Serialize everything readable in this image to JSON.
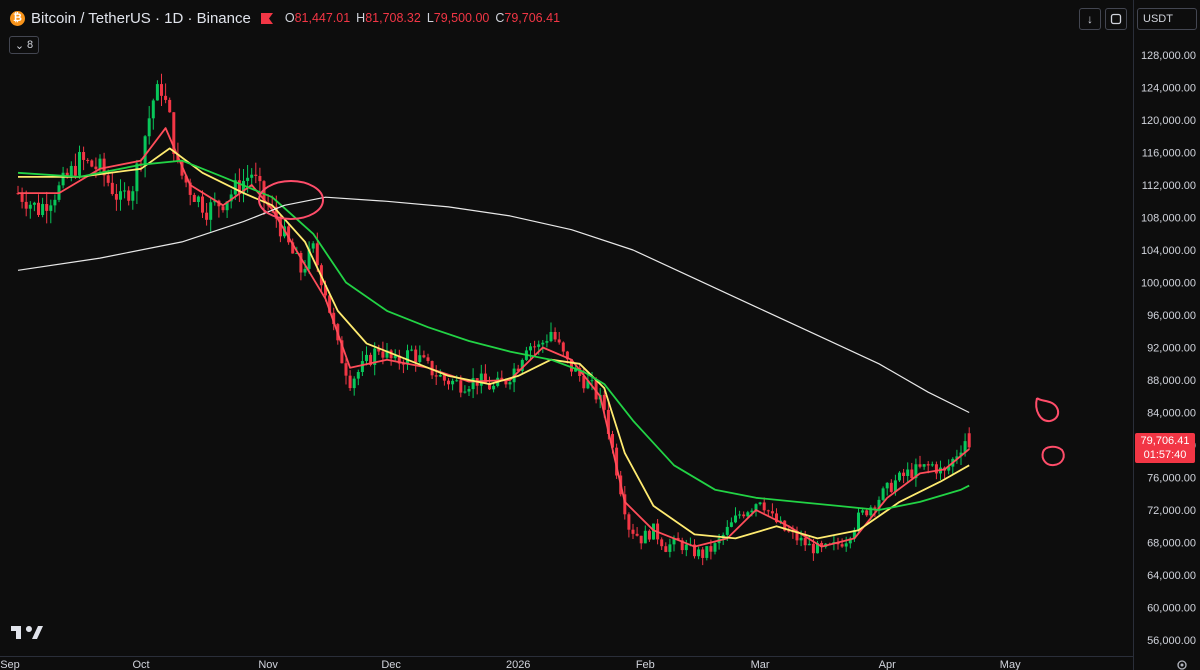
{
  "header": {
    "symbol": "Bitcoin / TetherUS · 1D · Binance",
    "coin_glyph": "₿",
    "ohlc": [
      {
        "key": "O",
        "value": "81,447.01"
      },
      {
        "key": "H",
        "value": "81,708.32"
      },
      {
        "key": "L",
        "value": "79,500.00"
      },
      {
        "key": "C",
        "value": "79,706.41"
      }
    ],
    "down_color": "#f23645",
    "up_color": "#08c75a"
  },
  "indicators": {
    "count": "8"
  },
  "toolbar": {
    "currency": "USDT"
  },
  "price_label": {
    "price": "79,706.41",
    "countdown": "01:57:40"
  },
  "chart_data": {
    "type": "line",
    "title": "",
    "ylim": [
      54000,
      130000
    ],
    "y_ticks": [
      128000,
      124000,
      120000,
      116000,
      112000,
      108000,
      104000,
      100000,
      96000,
      92000,
      88000,
      84000,
      80000,
      76000,
      72000,
      68000,
      64000,
      60000,
      56000
    ],
    "y_tick_labels": [
      "128,000.00",
      "124,000.00",
      "120,000.00",
      "116,000.00",
      "112,000.00",
      "108,000.00",
      "104,000.00",
      "100,000.00",
      "96,000.00",
      "92,000.00",
      "88,000.00",
      "84,000.00",
      "80,000.00",
      "76,000.00",
      "72,000.00",
      "68,000.00",
      "64,000.00",
      "60,000.00",
      "56,000.00"
    ],
    "x_ticks": [
      "Sep",
      "Oct",
      "Nov",
      "Dec",
      "2026",
      "Feb",
      "Mar",
      "Apr",
      "May"
    ],
    "x_tick_days": [
      0,
      30,
      61,
      91,
      122,
      153,
      181,
      212,
      242
    ],
    "grid": false,
    "candles": {
      "name": "BTC/USDT 1D",
      "path": [
        [
          0,
          111000
        ],
        [
          5,
          109000
        ],
        [
          10,
          111500
        ],
        [
          15,
          115000
        ],
        [
          20,
          114000
        ],
        [
          25,
          110000
        ],
        [
          28,
          112000
        ],
        [
          30,
          116000
        ],
        [
          33,
          122500
        ],
        [
          35,
          124000
        ],
        [
          37,
          120000
        ],
        [
          39,
          114000
        ],
        [
          42,
          111500
        ],
        [
          46,
          109000
        ],
        [
          50,
          110000
        ],
        [
          54,
          112000
        ],
        [
          57,
          113500
        ],
        [
          60,
          110000
        ],
        [
          63,
          108000
        ],
        [
          66,
          104500
        ],
        [
          69,
          101500
        ],
        [
          72,
          104000
        ],
        [
          75,
          99000
        ],
        [
          78,
          92000
        ],
        [
          81,
          88000
        ],
        [
          84,
          89500
        ],
        [
          88,
          92000
        ],
        [
          92,
          90000
        ],
        [
          96,
          91500
        ],
        [
          100,
          89500
        ],
        [
          104,
          88000
        ],
        [
          108,
          87500
        ],
        [
          112,
          88000
        ],
        [
          116,
          87000
        ],
        [
          119,
          88000
        ],
        [
          122,
          90000
        ],
        [
          124,
          92500
        ],
        [
          127,
          92000
        ],
        [
          130,
          94000
        ],
        [
          132,
          92000
        ],
        [
          134,
          90000
        ],
        [
          137,
          88500
        ],
        [
          140,
          87000
        ],
        [
          143,
          84500
        ],
        [
          146,
          77000
        ],
        [
          149,
          70000
        ],
        [
          152,
          68500
        ],
        [
          155,
          69500
        ],
        [
          158,
          67500
        ],
        [
          161,
          68000
        ],
        [
          164,
          67000
        ],
        [
          167,
          66500
        ],
        [
          170,
          67500
        ],
        [
          173,
          69500
        ],
        [
          176,
          71500
        ],
        [
          179,
          72500
        ],
        [
          181,
          73500
        ],
        [
          184,
          71000
        ],
        [
          187,
          69500
        ],
        [
          190,
          68500
        ],
        [
          193,
          67500
        ],
        [
          196,
          67000
        ],
        [
          199,
          67500
        ],
        [
          202,
          68500
        ],
        [
          205,
          71000
        ],
        [
          208,
          72500
        ],
        [
          211,
          74000
        ],
        [
          214,
          75500
        ],
        [
          217,
          76500
        ],
        [
          220,
          77000
        ],
        [
          223,
          77500
        ],
        [
          226,
          76500
        ],
        [
          229,
          79000
        ],
        [
          232,
          81500
        ]
      ],
      "last_close": 79706.41
    },
    "series": [
      {
        "name": "",
        "color": "#ff4d5a",
        "values": [
          [
            0,
            111000
          ],
          [
            10,
            111000
          ],
          [
            20,
            114000
          ],
          [
            30,
            115000
          ],
          [
            36,
            119000
          ],
          [
            42,
            112000
          ],
          [
            50,
            109500
          ],
          [
            57,
            112000
          ],
          [
            62,
            109000
          ],
          [
            69,
            103000
          ],
          [
            75,
            98000
          ],
          [
            81,
            89500
          ],
          [
            90,
            90500
          ],
          [
            100,
            89500
          ],
          [
            110,
            87800
          ],
          [
            120,
            88000
          ],
          [
            128,
            92000
          ],
          [
            135,
            90500
          ],
          [
            142,
            86000
          ],
          [
            148,
            73000
          ],
          [
            155,
            69500
          ],
          [
            165,
            67500
          ],
          [
            173,
            68500
          ],
          [
            180,
            72000
          ],
          [
            188,
            70000
          ],
          [
            196,
            67500
          ],
          [
            204,
            68500
          ],
          [
            212,
            73500
          ],
          [
            220,
            76500
          ],
          [
            226,
            77000
          ],
          [
            232,
            79500
          ]
        ]
      },
      {
        "name": "",
        "color": "#ffeb70",
        "values": [
          [
            0,
            113000
          ],
          [
            15,
            113000
          ],
          [
            30,
            114000
          ],
          [
            37,
            116500
          ],
          [
            45,
            113500
          ],
          [
            55,
            111000
          ],
          [
            62,
            109500
          ],
          [
            70,
            105000
          ],
          [
            78,
            96500
          ],
          [
            85,
            92500
          ],
          [
            95,
            90500
          ],
          [
            105,
            88500
          ],
          [
            115,
            87500
          ],
          [
            122,
            88500
          ],
          [
            130,
            90500
          ],
          [
            137,
            90000
          ],
          [
            143,
            87000
          ],
          [
            148,
            79000
          ],
          [
            155,
            72500
          ],
          [
            165,
            69000
          ],
          [
            175,
            68500
          ],
          [
            185,
            70000
          ],
          [
            195,
            68500
          ],
          [
            205,
            69500
          ],
          [
            215,
            73000
          ],
          [
            225,
            75500
          ],
          [
            232,
            77500
          ]
        ]
      },
      {
        "name": "",
        "color": "#22d345",
        "values": [
          [
            0,
            113500
          ],
          [
            15,
            113000
          ],
          [
            30,
            114500
          ],
          [
            40,
            115000
          ],
          [
            50,
            113000
          ],
          [
            62,
            110500
          ],
          [
            72,
            106000
          ],
          [
            80,
            100000
          ],
          [
            90,
            96500
          ],
          [
            100,
            94500
          ],
          [
            110,
            92800
          ],
          [
            120,
            91500
          ],
          [
            130,
            90500
          ],
          [
            138,
            89000
          ],
          [
            143,
            87500
          ],
          [
            150,
            83000
          ],
          [
            160,
            77500
          ],
          [
            170,
            74500
          ],
          [
            180,
            73500
          ],
          [
            190,
            73000
          ],
          [
            200,
            72500
          ],
          [
            210,
            72000
          ],
          [
            220,
            73000
          ],
          [
            230,
            74500
          ],
          [
            232,
            75000
          ]
        ]
      },
      {
        "name": "",
        "color": "#e8e8e8",
        "values": [
          [
            0,
            101500
          ],
          [
            20,
            103000
          ],
          [
            40,
            105000
          ],
          [
            55,
            107500
          ],
          [
            65,
            109500
          ],
          [
            75,
            110500
          ],
          [
            90,
            110000
          ],
          [
            105,
            109300
          ],
          [
            120,
            108200
          ],
          [
            135,
            106500
          ],
          [
            150,
            104000
          ],
          [
            165,
            100500
          ],
          [
            180,
            97000
          ],
          [
            195,
            93500
          ],
          [
            210,
            90000
          ],
          [
            222,
            86500
          ],
          [
            232,
            84000
          ]
        ]
      }
    ]
  }
}
